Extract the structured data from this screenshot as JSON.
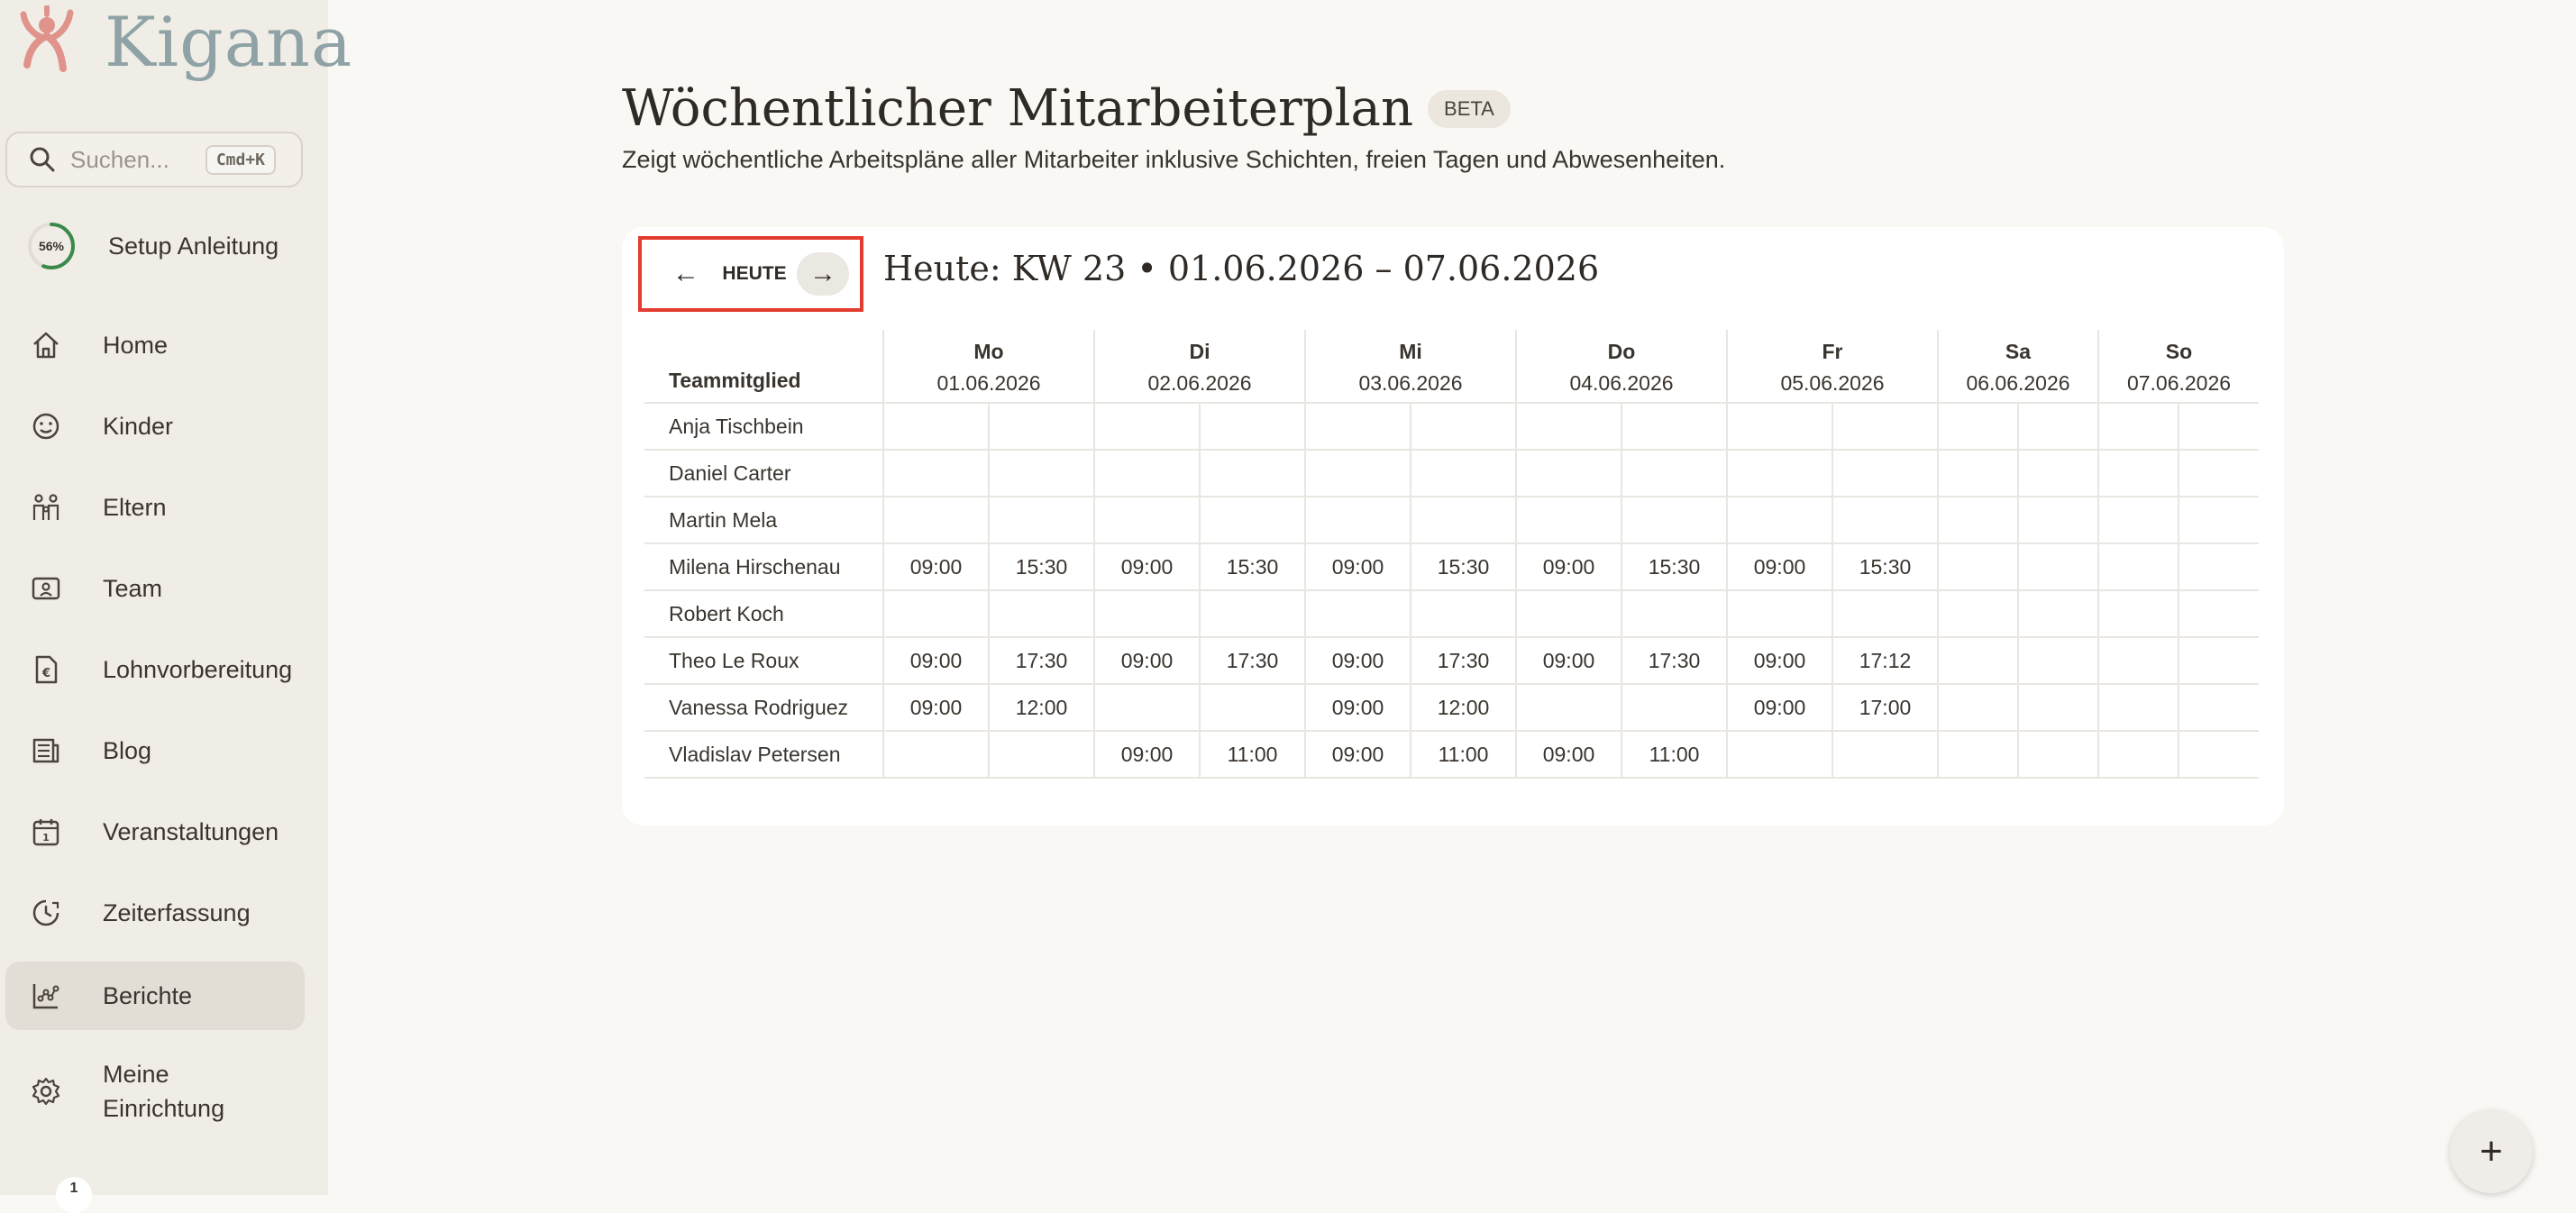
{
  "app": {
    "name": "Kigana"
  },
  "search": {
    "placeholder": "Suchen...",
    "shortcut": "Cmd+K"
  },
  "setup": {
    "progress": "56%",
    "progress_fraction": 0.56,
    "label": "Setup Anleitung"
  },
  "sidebar": {
    "items": [
      {
        "label": "Home",
        "icon": "home-icon",
        "active": false
      },
      {
        "label": "Kinder",
        "icon": "smiley-icon",
        "active": false
      },
      {
        "label": "Eltern",
        "icon": "family-icon",
        "active": false
      },
      {
        "label": "Team",
        "icon": "id-card-icon",
        "active": false
      },
      {
        "label": "Lohnvorbereitung",
        "icon": "euro-document-icon",
        "active": false
      },
      {
        "label": "Blog",
        "icon": "newspaper-icon",
        "active": false
      },
      {
        "label": "Veranstaltungen",
        "icon": "calendar-icon",
        "active": false
      },
      {
        "label": "Zeiterfassung",
        "icon": "clock-icon",
        "active": false
      },
      {
        "label": "Berichte",
        "icon": "chart-icon",
        "active": true
      },
      {
        "label": "Meine\nEinrichtung",
        "icon": "gear-icon",
        "active": false
      }
    ],
    "bottom_badge": "1"
  },
  "page": {
    "title": "Wöchentlicher Mitarbeiterplan",
    "badge": "BETA",
    "subtitle": "Zeigt wöchentliche Arbeitspläne aller Mitarbeiter inklusive Schichten, freien Tagen und Abwesenheiten."
  },
  "week_nav": {
    "prev": "←",
    "today": "HEUTE",
    "next": "→"
  },
  "week_title": "Heute: KW 23 • 01.06.2026 – 07.06.2026",
  "table": {
    "member_header": "Teammitglied",
    "days": [
      {
        "day": "Mo",
        "date": "01.06.2026"
      },
      {
        "day": "Di",
        "date": "02.06.2026"
      },
      {
        "day": "Mi",
        "date": "03.06.2026"
      },
      {
        "day": "Do",
        "date": "04.06.2026"
      },
      {
        "day": "Fr",
        "date": "05.06.2026"
      },
      {
        "day": "Sa",
        "date": "06.06.2026"
      },
      {
        "day": "So",
        "date": "07.06.2026"
      }
    ],
    "rows": [
      {
        "name": "Anja Tischbein",
        "times": [
          "",
          "",
          "",
          "",
          "",
          "",
          "",
          "",
          "",
          "",
          "",
          "",
          "",
          ""
        ]
      },
      {
        "name": "Daniel Carter",
        "times": [
          "",
          "",
          "",
          "",
          "",
          "",
          "",
          "",
          "",
          "",
          "",
          "",
          "",
          ""
        ]
      },
      {
        "name": "Martin Mela",
        "times": [
          "",
          "",
          "",
          "",
          "",
          "",
          "",
          "",
          "",
          "",
          "",
          "",
          "",
          ""
        ]
      },
      {
        "name": "Milena Hirschenau",
        "times": [
          "09:00",
          "15:30",
          "09:00",
          "15:30",
          "09:00",
          "15:30",
          "09:00",
          "15:30",
          "09:00",
          "15:30",
          "",
          "",
          "",
          ""
        ]
      },
      {
        "name": "Robert Koch",
        "times": [
          "",
          "",
          "",
          "",
          "",
          "",
          "",
          "",
          "",
          "",
          "",
          "",
          "",
          ""
        ]
      },
      {
        "name": "Theo Le Roux",
        "times": [
          "09:00",
          "17:30",
          "09:00",
          "17:30",
          "09:00",
          "17:30",
          "09:00",
          "17:30",
          "09:00",
          "17:12",
          "",
          "",
          "",
          ""
        ]
      },
      {
        "name": "Vanessa Rodriguez",
        "times": [
          "09:00",
          "12:00",
          "",
          "",
          "09:00",
          "12:00",
          "",
          "",
          "09:00",
          "17:00",
          "",
          "",
          "",
          ""
        ]
      },
      {
        "name": "Vladislav Petersen",
        "times": [
          "",
          "",
          "09:00",
          "11:00",
          "09:00",
          "11:00",
          "09:00",
          "11:00",
          "",
          "",
          "",
          "",
          "",
          ""
        ]
      }
    ]
  },
  "fab": {
    "label": "+"
  },
  "colors": {
    "accent_ring": "#3c8a4a",
    "highlight_border": "#e33b2e",
    "logo": "#e0938a"
  }
}
